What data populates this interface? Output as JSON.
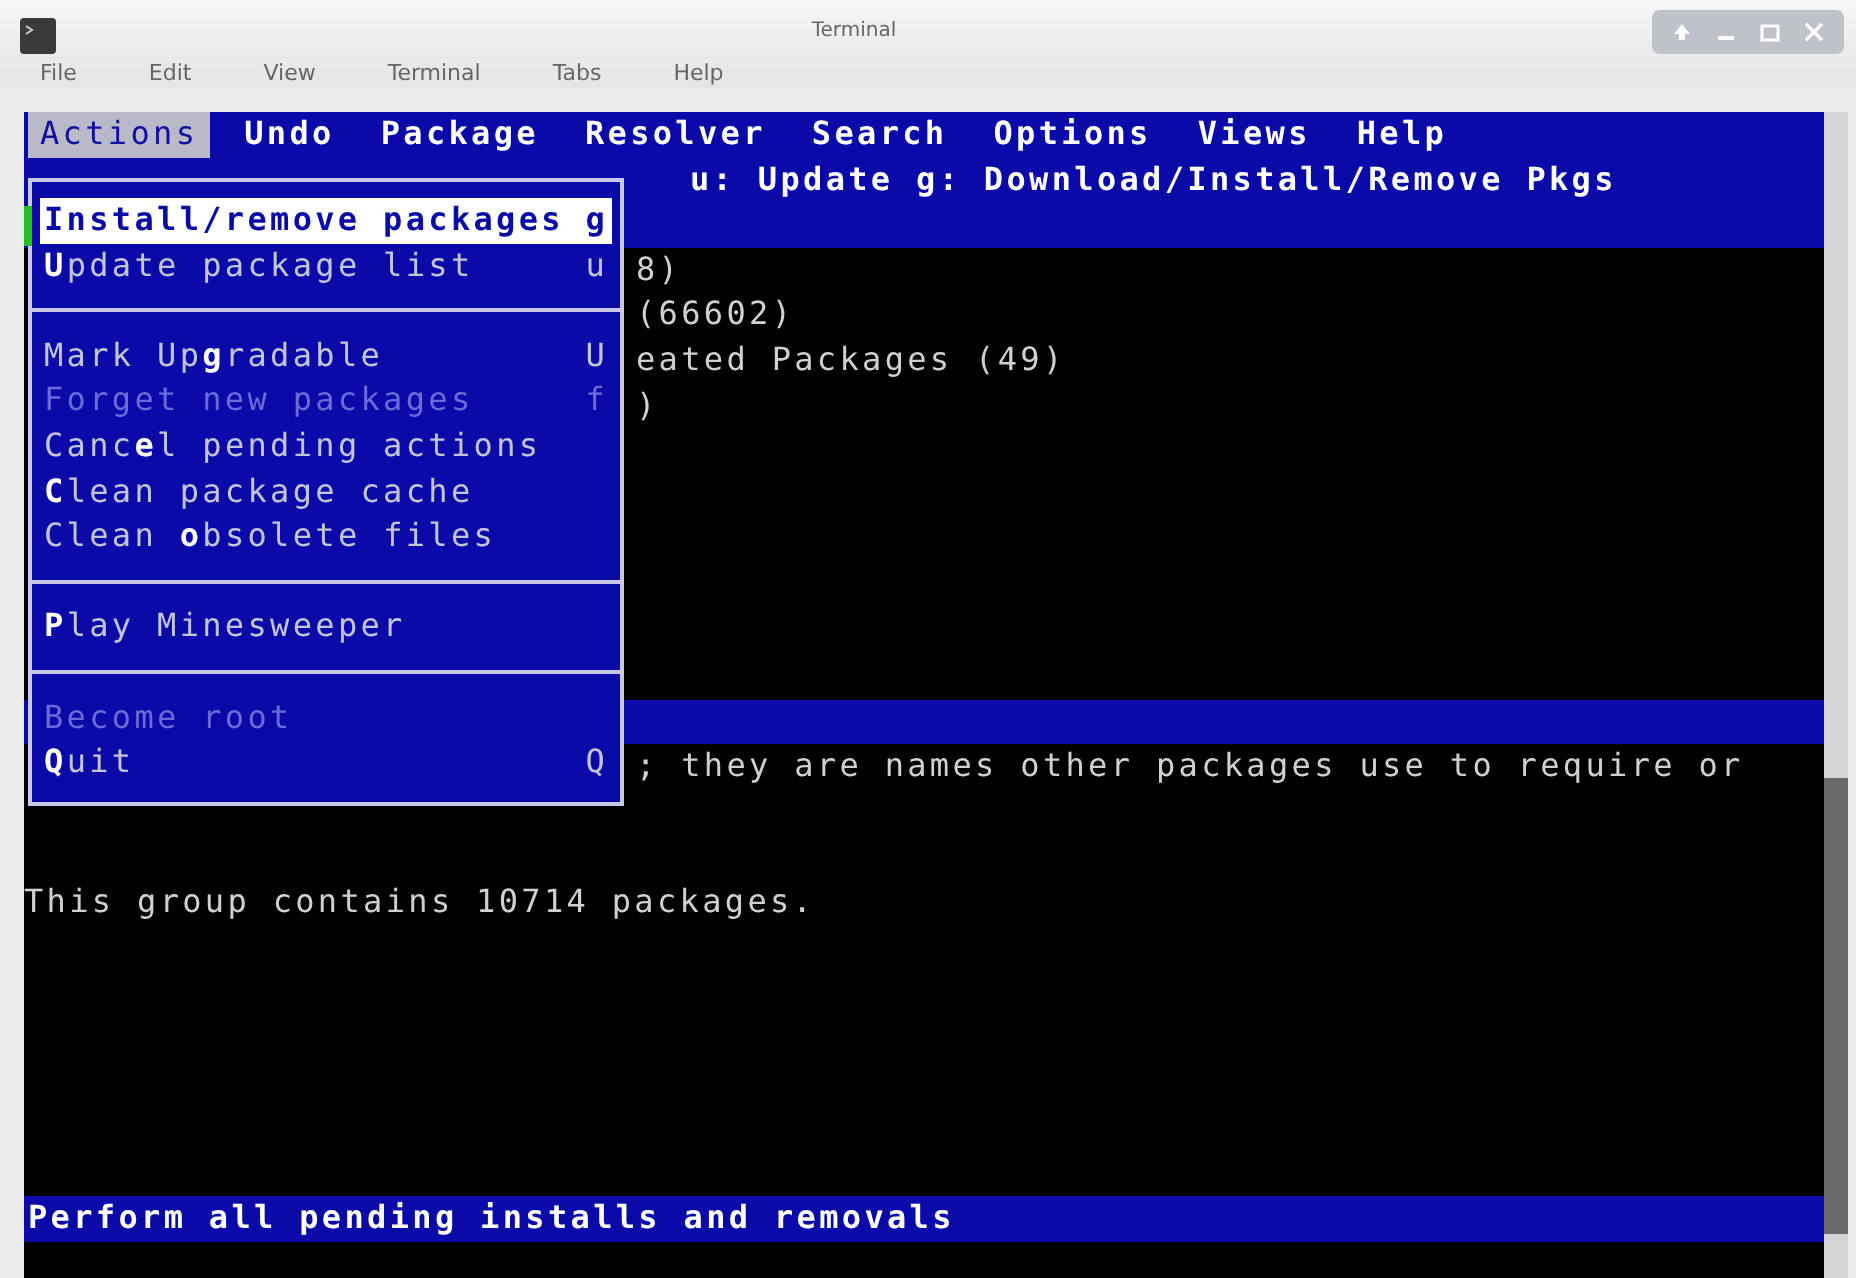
{
  "window": {
    "title": "Terminal"
  },
  "terminal_menu": [
    "File",
    "Edit",
    "View",
    "Terminal",
    "Tabs",
    "Help"
  ],
  "menubar": [
    {
      "label": "Actions",
      "selected": true
    },
    {
      "label": "Undo",
      "selected": false
    },
    {
      "label": "Package",
      "selected": false
    },
    {
      "label": "Resolver",
      "selected": false
    },
    {
      "label": "Search",
      "selected": false
    },
    {
      "label": "Options",
      "selected": false
    },
    {
      "label": "Views",
      "selected": false
    },
    {
      "label": "Help",
      "selected": false
    }
  ],
  "key_hint": "u: Update  g: Download/Install/Remove Pkgs",
  "actions_menu": [
    {
      "kind": "item",
      "label": "Install/remove packages",
      "shortcut": "g",
      "selected": true,
      "disabled": false
    },
    {
      "kind": "item",
      "label": "**U**pdate package list",
      "shortcut": "u",
      "selected": false,
      "disabled": false
    },
    {
      "kind": "separator"
    },
    {
      "kind": "item",
      "label": "Mark Up**g**radable",
      "shortcut": "U",
      "selected": false,
      "disabled": false
    },
    {
      "kind": "item",
      "label": "Forget new packages",
      "shortcut": "f",
      "selected": false,
      "disabled": true
    },
    {
      "kind": "item",
      "label": "Canc**e**l pending actions",
      "selected": false,
      "disabled": false
    },
    {
      "kind": "item",
      "label": "**C**lean package cache",
      "selected": false,
      "disabled": false
    },
    {
      "kind": "item",
      "label": "Clean **o**bsolete files",
      "selected": false,
      "disabled": false
    },
    {
      "kind": "separator"
    },
    {
      "kind": "item",
      "label": "**P**lay Minesweeper",
      "selected": false,
      "disabled": false
    },
    {
      "kind": "separator"
    },
    {
      "kind": "item",
      "label": "Become root",
      "selected": false,
      "disabled": true
    },
    {
      "kind": "item",
      "label": "**Q**uit",
      "shortcut": "Q",
      "selected": false,
      "disabled": false
    }
  ],
  "package_list_fragments": [
    "8)",
    "(66602)",
    "eated Packages (49)",
    ")"
  ],
  "description_fragment": "; they are names other packages use to require or",
  "description": "This group contains 10714 packages.",
  "status_bar": "Perform all pending installs and removals"
}
